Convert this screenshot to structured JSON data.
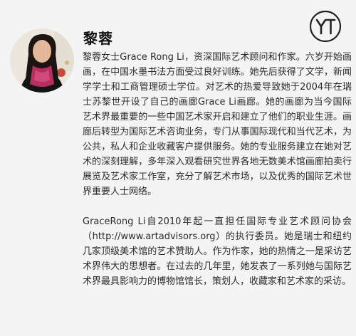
{
  "profile": {
    "name": "黎蓉",
    "bio_paragraphs": [
      "黎蓉女士Grace Rong Li，资深国际艺术顾问和作家。六岁开始画画，在中国水墨书法方面受过良好训练。她先后获得了文学，新闻学学士和工商管理硕士学位。对艺术的热爱导致她于2004年在瑞士苏黎世开设了自己的画廊Grace Li画廊。她的画廊为当今国际艺术界最重要的一些中国艺术家开启和建立了他们的职业生涯。画廊后转型为国际艺术咨询业务，专门从事国际现代和当代艺术，为公共，私人和企业收藏客户提供服务。她的专业服务建立在她对艺术的深刻理解，多年深入观看研究世界各地无数美术馆画廊拍卖行展览及艺术家工作室，充分了解艺术市场，以及优秀的国际艺术世界重要人士网络。",
      "GraceRong Li自2010年起一直担任国际专业艺术顾问协会（http://www.artadvisors.org）的执行委员。她是瑞士和纽约几家顶级美术馆的艺术赞助人。作为作家，她的热情之一是采访艺术界伟大的思想者。在过去的几年里，她发表了一系列她与国际艺术界最具影响力的博物馆馆长，策划人，收藏家和艺术家的采访。"
    ]
  },
  "logo": {
    "text": "YT"
  },
  "colors": {
    "background": "#f4f4f4",
    "scarf": "#b5305f",
    "text": "#2b2b2b"
  }
}
